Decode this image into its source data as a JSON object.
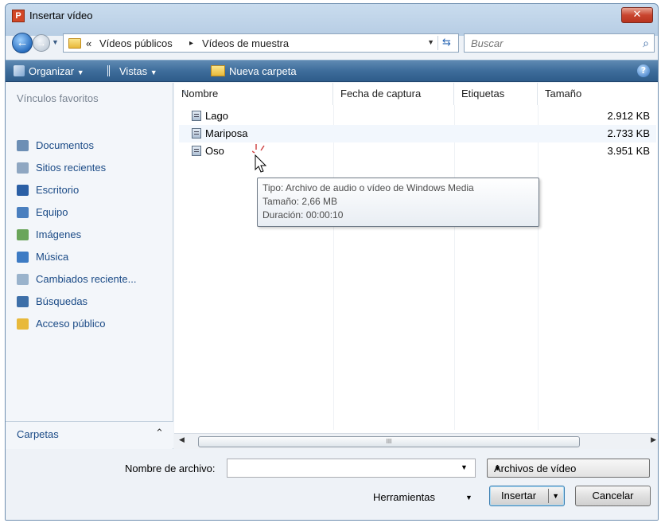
{
  "window": {
    "title": "Insertar vídeo",
    "close_glyph": "✕",
    "app_icon_letter": "P"
  },
  "address_bar": {
    "prefix": "«",
    "path": [
      "Vídeos públicos",
      "Vídeos de muestra"
    ],
    "separator": "▸"
  },
  "search": {
    "placeholder": "Buscar"
  },
  "toolbar": {
    "organize": "Organizar",
    "views": "Vistas",
    "new_folder": "Nueva carpeta",
    "help": "?"
  },
  "sidebar": {
    "heading": "Vínculos favoritos",
    "items": [
      {
        "label": "Documentos",
        "icon": "documents-icon",
        "color": "#6d8fb5"
      },
      {
        "label": "Sitios recientes",
        "icon": "recent-places-icon",
        "color": "#8fa7c2"
      },
      {
        "label": "Escritorio",
        "icon": "desktop-icon",
        "color": "#2b5fa5"
      },
      {
        "label": "Equipo",
        "icon": "computer-icon",
        "color": "#4a7fbf"
      },
      {
        "label": "Imágenes",
        "icon": "pictures-icon",
        "color": "#6aa55a"
      },
      {
        "label": "Música",
        "icon": "music-icon",
        "color": "#3d7bc4"
      },
      {
        "label": "Cambiados reciente...",
        "icon": "recently-changed-icon",
        "color": "#9ab3cc"
      },
      {
        "label": "Búsquedas",
        "icon": "searches-icon",
        "color": "#3d6fa8"
      },
      {
        "label": "Acceso público",
        "icon": "public-folder-icon",
        "color": "#e8b93b"
      }
    ],
    "folders_label": "Carpetas"
  },
  "file_list": {
    "columns": [
      "Nombre",
      "Fecha de captura",
      "Etiquetas",
      "Tamaño"
    ],
    "rows": [
      {
        "name": "Lago",
        "size": "2.912 KB"
      },
      {
        "name": "Mariposa",
        "size": "2.733 KB"
      },
      {
        "name": "Oso",
        "size": "3.951 KB"
      }
    ]
  },
  "tooltip": {
    "type": "Tipo: Archivo de audio o vídeo de Windows Media",
    "size": "Tamaño: 2,66 MB",
    "duration": "Duración: 00:00:10"
  },
  "scrollbar": {
    "grip": "III"
  },
  "bottom": {
    "filename_label": "Nombre de archivo:",
    "filename_value": "",
    "filetype": "Archivos de vídeo",
    "tools": "Herramientas",
    "insert": "Insertar",
    "cancel": "Cancelar"
  }
}
